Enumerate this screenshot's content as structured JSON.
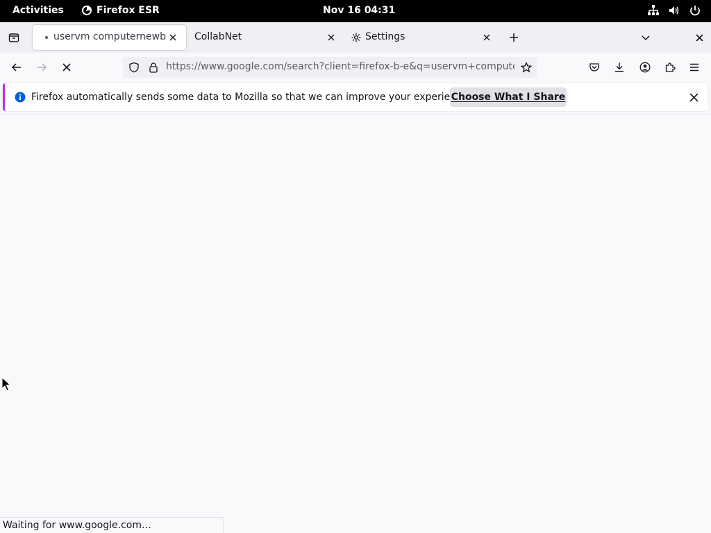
{
  "system": {
    "activities": "Activities",
    "app_name": "Firefox ESR",
    "clock": "Nov 16  04:31"
  },
  "tabs": [
    {
      "label": "uservm computernewb -"
    },
    {
      "label": "CollabNet"
    },
    {
      "label": "Settings"
    }
  ],
  "nav": {
    "url": "https://www.google.com/search?client=firefox-b-e&q=uservm+computer"
  },
  "infobar": {
    "message": "Firefox automatically sends some data to Mozilla so that we can improve your experience.",
    "button_label": "Choose What I Share"
  },
  "status": {
    "text": "Waiting for www.google.com…"
  },
  "colors": {
    "accent": "#b833e1",
    "info": "#0060df"
  }
}
